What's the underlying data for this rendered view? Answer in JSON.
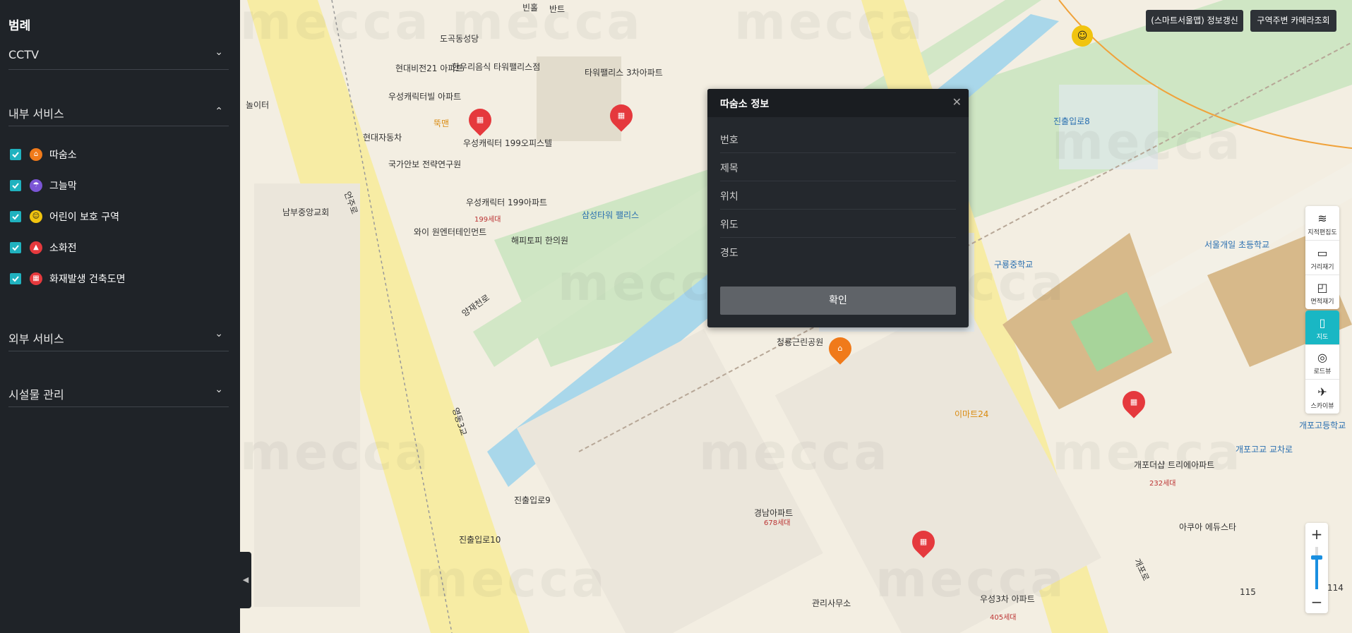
{
  "sidebar": {
    "legend_title": "범례",
    "sections": [
      {
        "label": "CCTV",
        "chevron": "chevron-down"
      },
      {
        "label": "내부 서비스",
        "chevron": "chevron-up"
      },
      {
        "label": "외부 서비스",
        "chevron": "chevron-down"
      },
      {
        "label": "시설물 관리",
        "chevron": "chevron-down"
      }
    ],
    "items": [
      {
        "label": "따숨소",
        "icon": "house-icon",
        "checked": true,
        "color": "#f07a1a"
      },
      {
        "label": "그늘막",
        "icon": "umbrella-icon",
        "checked": true,
        "color": "#7b55d6"
      },
      {
        "label": "어린이 보호 구역",
        "icon": "children-icon",
        "checked": true,
        "color": "#f1c40f"
      },
      {
        "label": "소화전",
        "icon": "hydrant-icon",
        "checked": true,
        "color": "#e5393d"
      },
      {
        "label": "화재발생 건축도면",
        "icon": "blueprint-icon",
        "checked": true,
        "color": "#e5393d"
      }
    ]
  },
  "header_buttons": {
    "refresh": "(스마트서울맵) 정보갱신",
    "camera": "구역주변 카메라조회"
  },
  "tools": [
    {
      "label": "지적편집도",
      "icon": "layers-icon",
      "active": false
    },
    {
      "label": "거리재기",
      "icon": "ruler-icon",
      "active": false
    },
    {
      "label": "면적재기",
      "icon": "area-icon",
      "active": false
    },
    {
      "label": "지도",
      "icon": "map-icon",
      "active": true
    },
    {
      "label": "로드뷰",
      "icon": "roadview-icon",
      "active": false
    },
    {
      "label": "스카이뷰",
      "icon": "skyview-icon",
      "active": false
    }
  ],
  "zoom": {
    "plus": "+",
    "minus": "−"
  },
  "modal": {
    "title": "따숨소 정보",
    "fields": [
      {
        "label": "번호",
        "value": ""
      },
      {
        "label": "제목",
        "value": ""
      },
      {
        "label": "위치",
        "value": ""
      },
      {
        "label": "위도",
        "value": ""
      },
      {
        "label": "경도",
        "value": ""
      }
    ],
    "confirm": "확인"
  },
  "map_labels": [
    "빈홀",
    "반트",
    "도곡동성당",
    "현대비전21 아파트",
    "한우리음식 타워팰리스점",
    "우성캐릭터빌 아파트",
    "뚝맨",
    "우성캐릭터 199오피스텔",
    "타워팰리스 3차아파트",
    "현대자동차",
    "국가안보 전략연구원",
    "우성캐릭터 199아파트",
    "199세대",
    "와이 원엔터테인먼트",
    "해피토피 한의원",
    "삼성타워 팰리스",
    "남부중앙교회",
    "놀이터",
    "진출입로8",
    "서울개일 초등학교",
    "구룡중학교",
    "청룡근린공원",
    "이마트24",
    "개포더샵 트리에아파트",
    "232세대",
    "개포고등학교",
    "개포고교 교차로",
    "아쿠아 에듀스타",
    "경남아파트",
    "678세대",
    "관리사무소",
    "우성3차 아파트",
    "405세대",
    "진출입로9",
    "진출입로10",
    "양재천로",
    "언주로",
    "영동3교",
    "개포로",
    "115",
    "114"
  ],
  "watermark": "mecca"
}
